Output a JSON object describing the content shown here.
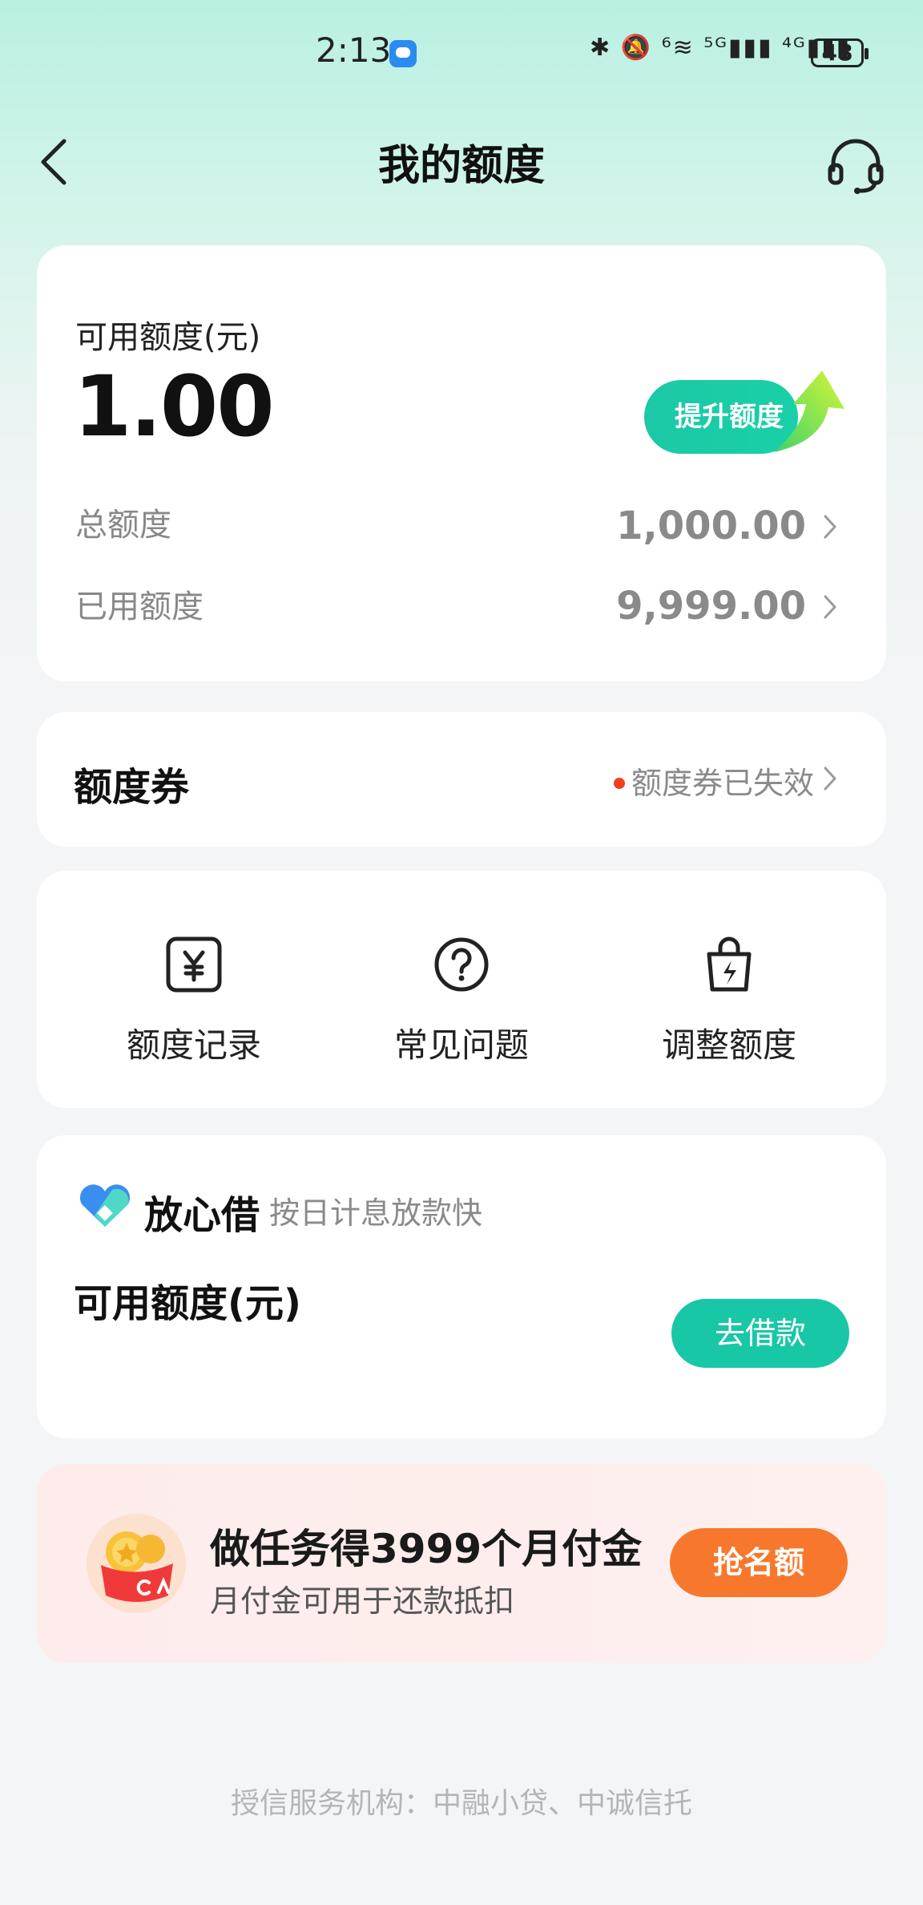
{
  "status_bar": {
    "time": "2:13",
    "icons_text": "✱ 🔕 ⁶≋ ⁵ᴳ▮▮▮ ⁴ᴳ▮▮▮",
    "battery": "48"
  },
  "header": {
    "title": "我的额度"
  },
  "quota": {
    "available_label": "可用额度(元)",
    "available_value": "1.00",
    "boost_button": "提升额度",
    "total_label": "总额度",
    "total_value": "1,000.00",
    "used_label": "已用额度",
    "used_value": "9,999.00"
  },
  "coupon": {
    "title": "额度券",
    "status": "额度券已失效",
    "status_color": "#f0401c"
  },
  "actions": [
    {
      "label": "额度记录",
      "icon": "yuan-card-icon"
    },
    {
      "label": "常见问题",
      "icon": "question-circle-icon"
    },
    {
      "label": "调整额度",
      "icon": "bolt-bag-icon"
    }
  ],
  "loan": {
    "brand": "放心借",
    "subtitle": "按日计息放款快",
    "available_label": "可用额度(元)",
    "button": "去借款"
  },
  "promo": {
    "title": "做任务得3999个月付金",
    "subtitle": "月付金可用于还款抵扣",
    "button": "抢名额"
  },
  "footer": {
    "text": "授信服务机构：中融小贷、中诚信托"
  },
  "colors": {
    "accent": "#18c7a6",
    "promo_button": "#f7782c"
  }
}
